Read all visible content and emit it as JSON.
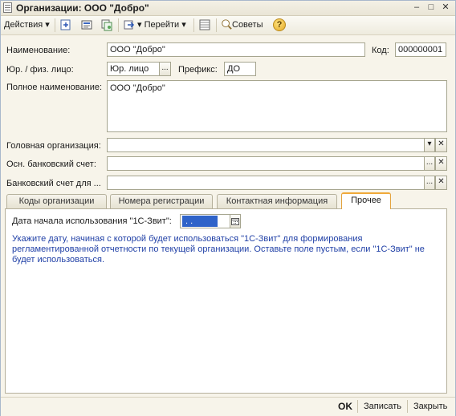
{
  "window": {
    "title": "Организации: ООО \"Добро\"",
    "minimize": "–",
    "maximize": "□",
    "close": "✕"
  },
  "toolbar": {
    "actions_label": "Действия",
    "goto_label": "Перейти",
    "tips_label": "Советы",
    "dropdown_arrow": "▾",
    "help_glyph": "?"
  },
  "form": {
    "name_label": "Наименование:",
    "name_value": "ООО \"Добро\"",
    "code_label": "Код:",
    "code_value": "000000001",
    "person_type_label": "Юр. / физ. лицо:",
    "person_type_value": "Юр. лицо",
    "prefix_label": "Префикс:",
    "prefix_value": "ДО",
    "full_name_label": "Полное наименование:",
    "full_name_value": "ООО \"Добро\"",
    "head_org_label": "Головная организация:",
    "head_org_value": "",
    "main_account_label": "Осн. банковский счет:",
    "main_account_value": "",
    "bank_account_label": "Банковский счет для ...",
    "bank_account_value": "",
    "ellipsis": "...",
    "clear_glyph": "✕",
    "dropdown_glyph": "▾"
  },
  "tabs": [
    {
      "label": "Коды организации"
    },
    {
      "label": "Номера регистрации"
    },
    {
      "label": "Контактная информация"
    },
    {
      "label": "Прочее"
    }
  ],
  "other_tab": {
    "date_label": "Дата начала использования \"1С-Звит\":",
    "date_value": " .  .",
    "hint": "Укажите дату, начиная с которой будет использоваться \"1С-Звит\" для формирования регламентированной отчетности по текущей организации. Оставьте поле пустым, если \"1С-Звит\" не будет использоваться.",
    "hint_color": "#1f3fa6"
  },
  "bottom": {
    "ok_label": "OK",
    "save_label": "Записать",
    "close_label": "Закрыть"
  }
}
